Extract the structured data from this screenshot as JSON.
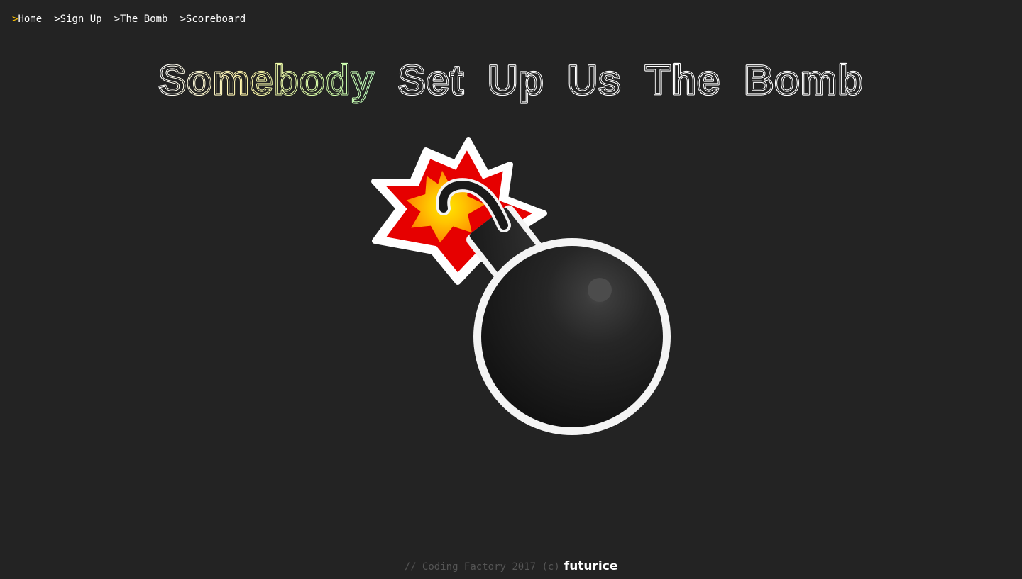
{
  "nav": {
    "items": [
      {
        "caret": ">",
        "label": "Home",
        "active": true
      },
      {
        "caret": ">",
        "label": "Sign Up",
        "active": false
      },
      {
        "caret": ">",
        "label": "The Bomb",
        "active": false
      },
      {
        "caret": ">",
        "label": "Scoreboard",
        "active": false
      }
    ]
  },
  "title": {
    "words": [
      "Somebody",
      "Set",
      "Up",
      "Us",
      "The",
      "Bomb"
    ],
    "rainbow_colors": [
      "#ffffff",
      "#fff4a8",
      "#d4ffa8",
      "#a8ffd8",
      "#a8d8ff",
      "#c8a8ff",
      "#ffa8e0",
      "#ffa8b8"
    ]
  },
  "colors": {
    "background": "#232323",
    "active_caret": "#ffc300",
    "fuse_red": "#e60000",
    "fuse_yellow": "#ffd400",
    "bomb_body": "#1a1a1a"
  },
  "footer": {
    "text": "// Coding Factory 2017 (c)",
    "brand": "futurice"
  },
  "icons": {
    "bomb": "bomb-icon",
    "explosion": "explosion-icon"
  }
}
